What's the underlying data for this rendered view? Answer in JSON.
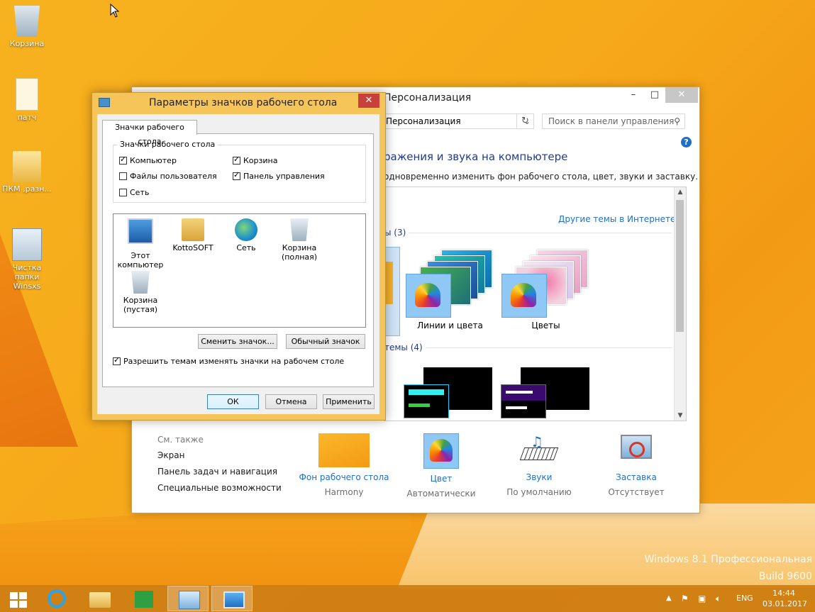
{
  "desktop": {
    "icons": [
      {
        "label": "Корзина"
      },
      {
        "label": "патч"
      },
      {
        "label": "ПКМ ,разн..."
      },
      {
        "label": "Чистка папки Winsxs"
      }
    ],
    "watermark_line1": "Windows 8.1 Профессиональная",
    "watermark_line2": "Build 9600"
  },
  "personalization": {
    "title": "Персонализация",
    "address": "Персонализация",
    "search_placeholder": "Поиск в панели управления",
    "heading": "ражения и звука на компьютере",
    "subheading": "одновременно изменить фон рабочего стола, цвет, звуки и заставку.",
    "other_themes_link": "Другие темы в Интернете",
    "group1_label": "ы (3)",
    "group2_label": "темы (4)",
    "themes": [
      {
        "name": "Линии и цвета"
      },
      {
        "name": "Цветы"
      }
    ],
    "see_also": {
      "title": "См. также",
      "links": [
        "Экран",
        "Панель задач и навигация",
        "Специальные возможности"
      ]
    },
    "bottom_items": [
      {
        "label": "Фон рабочего стола",
        "sub": "Harmony"
      },
      {
        "label": "Цвет",
        "sub": "Автоматически"
      },
      {
        "label": "Звуки",
        "sub": "По умолчанию"
      },
      {
        "label": "Заставка",
        "sub": "Отсутствует"
      }
    ]
  },
  "dialog": {
    "title": "Параметры значков рабочего стола",
    "tab_label": "Значки рабочего стола",
    "group_label": "Значки рабочего стола",
    "checkboxes": [
      {
        "label": "Компьютер",
        "checked": true
      },
      {
        "label": "Корзина",
        "checked": true
      },
      {
        "label": "Файлы пользователя",
        "checked": false
      },
      {
        "label": "Панель управления",
        "checked": true
      },
      {
        "label": "Сеть",
        "checked": false
      }
    ],
    "icons": [
      {
        "label": "Этот компьютер"
      },
      {
        "label": "KottoSOFT"
      },
      {
        "label": "Сеть"
      },
      {
        "label": "Корзина (полная)"
      },
      {
        "label": "Корзина (пустая)"
      }
    ],
    "change_icon_button": "Сменить значок...",
    "default_icon_button": "Обычный значок",
    "allow_themes_label": "Разрешить темам изменять значки на рабочем столе",
    "allow_themes_checked": true,
    "ok_button": "ОК",
    "cancel_button": "Отмена",
    "apply_button": "Применить"
  },
  "taskbar": {
    "language": "ENG",
    "time": "14:44",
    "date": "03.01.2017"
  }
}
